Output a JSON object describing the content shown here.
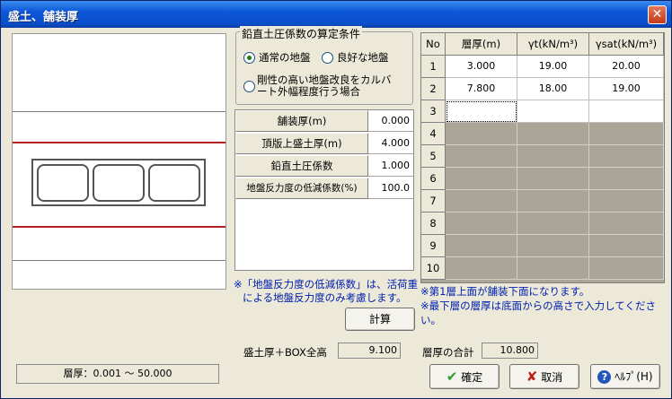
{
  "window": {
    "title": "盛土、舗装厚",
    "close_symbol": "✕"
  },
  "condition_group": {
    "legend": "鉛直土圧係数の算定条件",
    "options": [
      {
        "label": "通常の地盤",
        "selected": true
      },
      {
        "label": "良好な地盤",
        "selected": false
      },
      {
        "label": "剛性の高い地盤改良をカルバート外幅程度行う場合",
        "line1": "剛性の高い地盤改良をカルバ",
        "line2": "ート外幅程度行う場合",
        "selected": false
      }
    ]
  },
  "params": [
    {
      "label": "舗装厚(m)",
      "value": "0.000"
    },
    {
      "label": "頂版上盛土厚(m)",
      "value": "4.000"
    },
    {
      "label": "鉛直土圧係数",
      "value": "1.000"
    },
    {
      "label": "地盤反力度の低減係数(%)",
      "value": "100.0"
    }
  ],
  "note_reduction": {
    "line1": "※「地盤反力度の低減係数」は、活荷重",
    "line2": "による地盤反力度のみ考慮します。"
  },
  "calc_button": "計算",
  "layer_table": {
    "headers": [
      "No",
      "層厚(m)",
      "γt(kN/m³)",
      "γsat(kN/m³)"
    ],
    "rows": [
      {
        "no": "1",
        "thickness": "3.000",
        "gamma_t": "19.00",
        "gamma_sat": "20.00"
      },
      {
        "no": "2",
        "thickness": "7.800",
        "gamma_t": "18.00",
        "gamma_sat": "19.00"
      },
      {
        "no": "3",
        "thickness": "",
        "gamma_t": "",
        "gamma_sat": ""
      },
      {
        "no": "4"
      },
      {
        "no": "5"
      },
      {
        "no": "6"
      },
      {
        "no": "7"
      },
      {
        "no": "8"
      },
      {
        "no": "9"
      },
      {
        "no": "10"
      }
    ]
  },
  "table_notes": {
    "line1": "※第1層上面が舗装下面になります。",
    "line2": "※最下層の層厚は底面からの高さで入力してください。"
  },
  "totals": {
    "fill_box_label": "盛土厚＋BOX全高",
    "fill_box_value": "9.100",
    "layer_sum_label": "層厚の合計",
    "layer_sum_value": "10.800"
  },
  "status_text": "層厚：0.001 ～ 50.000",
  "buttons": {
    "ok": "確定",
    "cancel": "取消",
    "help": "ﾍﾙﾌﾟ(H)"
  },
  "colors": {
    "title_bar": "#0c57d8",
    "note_text": "#0020b0",
    "soil_line": "#b42020",
    "disabled_cell": "#aaa597"
  }
}
